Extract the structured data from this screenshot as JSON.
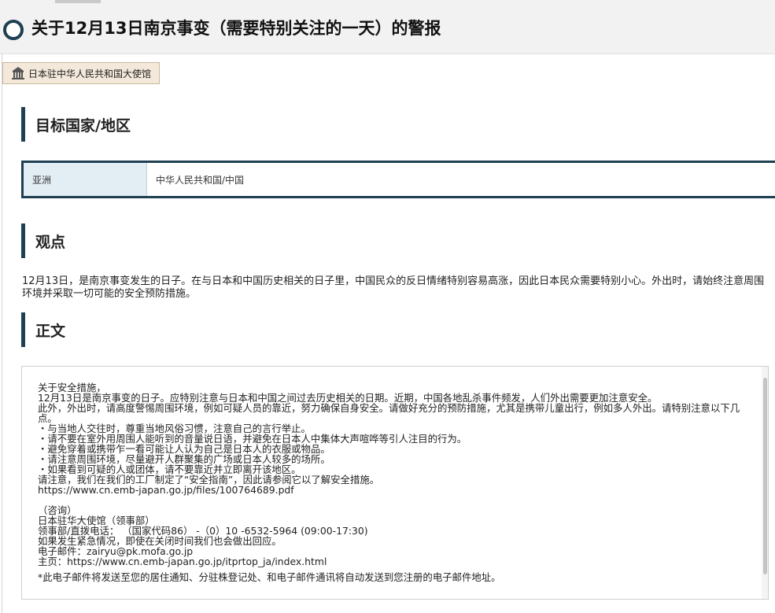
{
  "page": {
    "title": "关于12月13日南京事变（需要特别关注的一天）的警报",
    "source_tag": "日本驻中华人民共和国大使馆"
  },
  "sections": {
    "target": {
      "heading": "目标国家/地区",
      "region": "亚洲",
      "country": "中华人民共和国/中国"
    },
    "viewpoint": {
      "heading": "观点",
      "text": "12月13日，是南京事变发生的日子。在与日本和中国历史相关的日子里，中国民众的反日情绪特别容易高涨，因此日本民众需要特别小心。外出时，请始终注意周围环境并采取一切可能的安全预防措施。"
    },
    "body": {
      "heading": "正文",
      "lines": [
        "关于安全措施，",
        "12月13日是南京事变的日子。应特别注意与日本和中国之间过去历史相关的日期。近期，中国各地乱杀事件频发，人们外出需要更加注意安全。",
        "此外，外出时，请高度警惕周围环境，例如可疑人员的靠近，努力确保自身安全。请做好充分的预防措施，尤其是携带儿童出行，例如多人外出。请特别注意以下几点。",
        "・与当地人交往时，尊重当地风俗习惯，注意自己的言行举止。",
        "・请不要在室外用周围人能听到的音量说日语，并避免在日本人中集体大声喧哗等引人注目的行为。",
        "・避免穿着或携带乍一看可能让人认为自己是日本人的衣服或物品。",
        "・请注意周围环境，尽量避开人群聚集的广场或日本人较多的场所。",
        "・如果看到可疑的人或团体，请不要靠近并立即离开该地区。",
        "请注意，我们在我们的工厂制定了“安全指南”，因此请参阅它以了解安全措施。",
        "https://www.cn.emb-japan.go.jp/files/100764689.pdf",
        "",
        "（咨询）",
        "日本驻华大使馆（领事部）",
        "领事部/直拨电话： （国家代码86） -（0）10 -6532-5964 (09:00-17:30)",
        "如果发生紧急情况，即使在关闭时间我们也会做出回应。",
        "电子邮件：zairyu@pk.mofa.go.jp",
        "主页：https://www.cn.emb-japan.go.jp/itprtop_ja/index.html"
      ],
      "note": "*此电子邮件将发送至您的居住通知、分驻株登记处、和电子邮件通讯将自动发送到您注册的电子邮件地址。"
    }
  },
  "colors": {
    "accent": "#1f3f52",
    "header_bg": "#f2f2f2",
    "tag_bg": "#f3e8da",
    "region_bg": "#e3edf4"
  },
  "icons": {
    "title_marker": "ring-icon",
    "embassy": "building-icon"
  }
}
